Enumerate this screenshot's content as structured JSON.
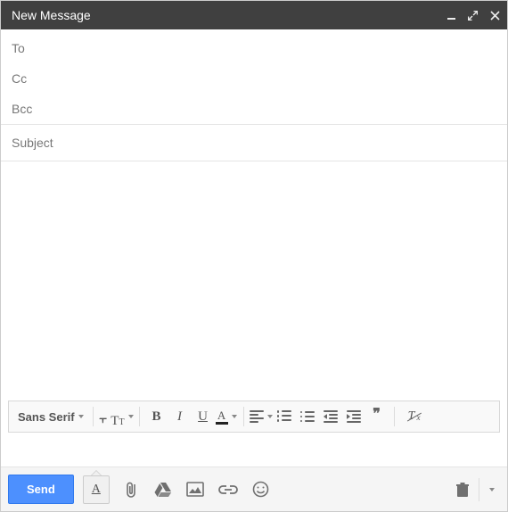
{
  "header": {
    "title": "New Message"
  },
  "fields": {
    "to_label": "To",
    "cc_label": "Cc",
    "bcc_label": "Bcc",
    "subject_label": "Subject"
  },
  "format": {
    "font_family": "Sans Serif",
    "size_large": "T",
    "size_small": "T",
    "bold": "B",
    "italic": "I",
    "underline": "U",
    "textcolor": "A",
    "quote": "❝",
    "remove_t": "T",
    "remove_x": "x"
  },
  "bottom": {
    "send": "Send",
    "format_toggle": "A"
  }
}
